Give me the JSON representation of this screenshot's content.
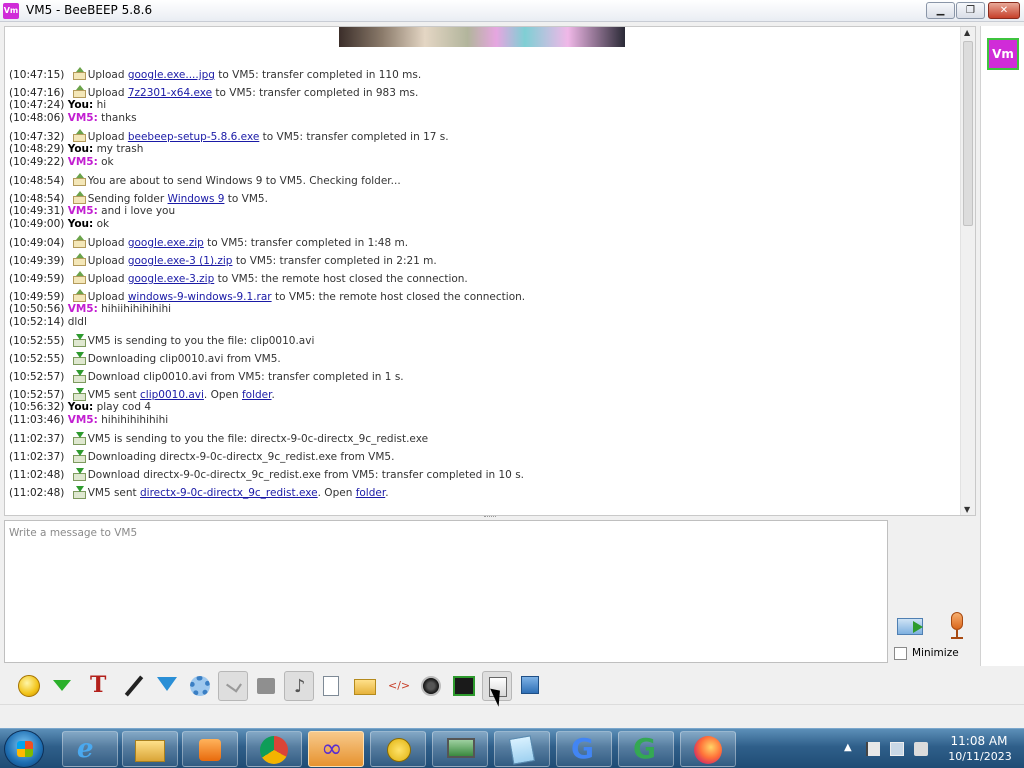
{
  "window": {
    "title": "VM5 - BeeBEEP 5.8.6",
    "app_icon_text": "Vm",
    "min_symbol": "▁",
    "max_symbol": "❐",
    "close_symbol": "✕"
  },
  "chat": {
    "messages": [
      {
        "time": "(10:47:15)",
        "kind": "system",
        "icon": "upload",
        "pre": "Upload ",
        "link": "google.exe....jpg",
        "post": " to VM5: transfer completed in 110 ms."
      },
      {
        "time": "(10:47:16)",
        "kind": "system",
        "icon": "upload",
        "pre": "Upload ",
        "link": "7z2301-x64.exe",
        "post": " to VM5: transfer completed in 983 ms."
      },
      {
        "time": "(10:47:24)",
        "kind": "chat",
        "sender": "You:",
        "text": " hi"
      },
      {
        "time": "(10:48:06)",
        "kind": "chat",
        "sender": "VM5:",
        "text": " thanks"
      },
      {
        "time": "(10:47:32)",
        "kind": "system",
        "icon": "upload",
        "pre": "Upload ",
        "link": "beebeep-setup-5.8.6.exe",
        "post": " to VM5: transfer completed in 17 s."
      },
      {
        "time": "(10:48:29)",
        "kind": "chat",
        "sender": "You:",
        "text": " my trash"
      },
      {
        "time": "(10:49:22)",
        "kind": "chat",
        "sender": "VM5:",
        "text": " ok"
      },
      {
        "time": "(10:48:54)",
        "kind": "system",
        "icon": "upload",
        "pre": "You are about to send Windows 9 to VM5. Checking folder...",
        "link": "",
        "post": ""
      },
      {
        "time": "(10:48:54)",
        "kind": "system",
        "icon": "upload",
        "pre": "Sending folder ",
        "link": "Windows 9",
        "post": " to VM5."
      },
      {
        "time": "(10:49:31)",
        "kind": "chat",
        "sender": "VM5:",
        "text": " and i love you"
      },
      {
        "time": "(10:49:00)",
        "kind": "chat",
        "sender": "You:",
        "text": " ok"
      },
      {
        "time": "(10:49:04)",
        "kind": "system",
        "icon": "upload",
        "pre": "Upload ",
        "link": "google.exe.zip",
        "post": " to VM5: transfer completed in 1:48 m."
      },
      {
        "time": "(10:49:39)",
        "kind": "system",
        "icon": "upload",
        "pre": "Upload ",
        "link": "google.exe-3 (1).zip",
        "post": " to VM5: transfer completed in 2:21 m."
      },
      {
        "time": "(10:49:59)",
        "kind": "system",
        "icon": "upload",
        "pre": "Upload ",
        "link": "google.exe-3.zip",
        "post": " to VM5: the remote host closed the connection."
      },
      {
        "time": "(10:49:59)",
        "kind": "system",
        "icon": "upload",
        "pre": "Upload ",
        "link": "windows-9-windows-9.1.rar",
        "post": " to VM5: the remote host closed the connection."
      },
      {
        "time": "(10:50:56)",
        "kind": "chat",
        "sender": "VM5:",
        "text": " hihiihihihihihi"
      },
      {
        "time": "(10:52:14)",
        "kind": "chat",
        "sender": "",
        "text": "   dldl"
      },
      {
        "time": "(10:52:55)",
        "kind": "system",
        "icon": "download",
        "pre": "VM5 is sending to you the file: clip0010.avi",
        "link": "",
        "post": ""
      },
      {
        "time": "(10:52:55)",
        "kind": "system",
        "icon": "download",
        "pre": "Downloading clip0010.avi from VM5.",
        "link": "",
        "post": ""
      },
      {
        "time": "(10:52:57)",
        "kind": "system",
        "icon": "download",
        "pre": "Download clip0010.avi from VM5: transfer completed in 1 s.",
        "link": "",
        "post": ""
      },
      {
        "time": "(10:52:57)",
        "kind": "system",
        "icon": "download",
        "pre": "VM5 sent ",
        "link": "clip0010.avi",
        "post": ". Open ",
        "link2": "folder",
        "post2": "."
      },
      {
        "time": "(10:56:32)",
        "kind": "chat",
        "sender": "You:",
        "text": " play cod 4"
      },
      {
        "time": "(11:03:46)",
        "kind": "chat",
        "sender": "VM5:",
        "text": " hihihihihihihi"
      },
      {
        "time": "(11:02:37)",
        "kind": "system",
        "icon": "download",
        "pre": "VM5 is sending to you the file: directx-9-0c-directx_9c_redist.exe",
        "link": "",
        "post": ""
      },
      {
        "time": "(11:02:37)",
        "kind": "system",
        "icon": "download",
        "pre": "Downloading directx-9-0c-directx_9c_redist.exe from VM5.",
        "link": "",
        "post": ""
      },
      {
        "time": "(11:02:48)",
        "kind": "system",
        "icon": "download",
        "pre": "Download directx-9-0c-directx_9c_redist.exe from VM5: transfer completed in 10 s.",
        "link": "",
        "post": ""
      },
      {
        "time": "(11:02:48)",
        "kind": "system",
        "icon": "download",
        "pre": "VM5 sent ",
        "link": "directx-9-0c-directx_9c_redist.exe",
        "post": ". Open ",
        "link2": "folder",
        "post2": "."
      }
    ]
  },
  "input": {
    "placeholder": "Write a message to VM5",
    "value": ""
  },
  "composer": {
    "minimize_label": "Minimize",
    "minimize_checked": false
  },
  "user_panel": {
    "avatar_text": "Vm"
  },
  "toolbar": {
    "tools": [
      "emoticons-icon",
      "chat-green-icon",
      "font-icon",
      "color-picker-icon",
      "filter-icon",
      "settings-icon",
      "spell-check-icon",
      "font-size-icon",
      "music-note-icon",
      "send-file-icon",
      "send-folder-icon",
      "html-code-icon",
      "screenshot-icon",
      "terminal-icon",
      "vote-icon",
      "save-chat-icon"
    ]
  },
  "taskbar": {
    "apps": [
      "ie-icon",
      "explorer-icon",
      "media-player-icon",
      "chrome-icon",
      "infinity-icon",
      "beebeep-icon",
      "network-icon",
      "notepad-icon",
      "google-icon",
      "google-icon",
      "firefox-icon"
    ],
    "time": "11:08 AM",
    "date": "10/11/2023",
    "tray": [
      "show-hidden-icon",
      "flag-icon",
      "network-tray-icon",
      "volume-muted-icon"
    ]
  },
  "colors": {
    "vm5_sender": "#c21ed1",
    "link": "#1a1aa6",
    "accent": "#d02cd8"
  }
}
